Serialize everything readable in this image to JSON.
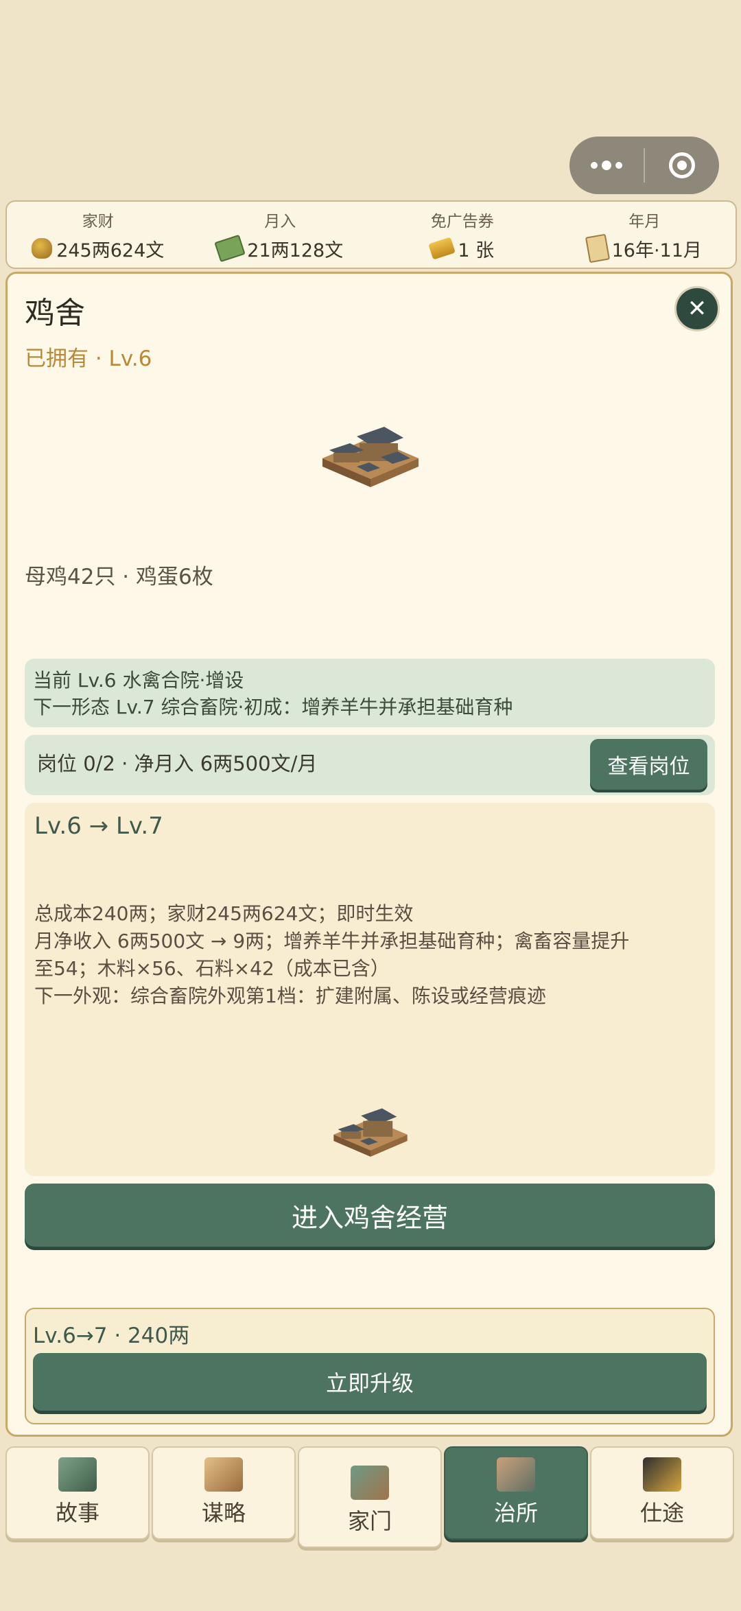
{
  "stats": [
    {
      "label": "家财",
      "value": "245两624文",
      "icon": "money-bag-icon"
    },
    {
      "label": "月入",
      "value": "21两128文",
      "icon": "cash-icon"
    },
    {
      "label": "免广告券",
      "value": "1 张",
      "icon": "ticket-icon"
    },
    {
      "label": "年月",
      "value": "16年·11月",
      "icon": "scroll-icon"
    }
  ],
  "building": {
    "title": "鸡舍",
    "owned": "已拥有 · Lv.6",
    "stock": "母鸡42只 · 鸡蛋6枚",
    "current_form": "当前 Lv.6 水禽合院·增设",
    "next_form": "下一形态 Lv.7 综合畜院·初成：增养羊牛并承担基础育种",
    "posts": "岗位 0/2 · 净月入 6两500文/月",
    "view_posts_button": "查看岗位"
  },
  "upgrade": {
    "level_change": "Lv.6 → Lv.7",
    "lines": [
      "总成本240两；家财245两624文；即时生效",
      "月净收入 6两500文 → 9两；增养羊牛并承担基础育种；禽畜容量提升",
      "至54；木料×56、石料×42（成本已含）",
      "下一外观：综合畜院外观第1档：扩建附属、陈设或经营痕迹"
    ]
  },
  "enter_button": "进入鸡舍经营",
  "quick_upgrade": {
    "label": "Lv.6→7 · 240两",
    "button": "立即升级"
  },
  "nav": [
    {
      "label": "故事",
      "icon": "story-book-icon",
      "active": false
    },
    {
      "label": "谋略",
      "icon": "strategy-scroll-icon",
      "active": false
    },
    {
      "label": "家门",
      "icon": "house-icon",
      "active": false
    },
    {
      "label": "治所",
      "icon": "pavilion-icon",
      "active": true
    },
    {
      "label": "仕途",
      "icon": "official-hat-icon",
      "active": false
    }
  ],
  "colors": {
    "background": "#efe4c7",
    "accent_green": "#4d7461",
    "gold_text": "#b9893a"
  }
}
